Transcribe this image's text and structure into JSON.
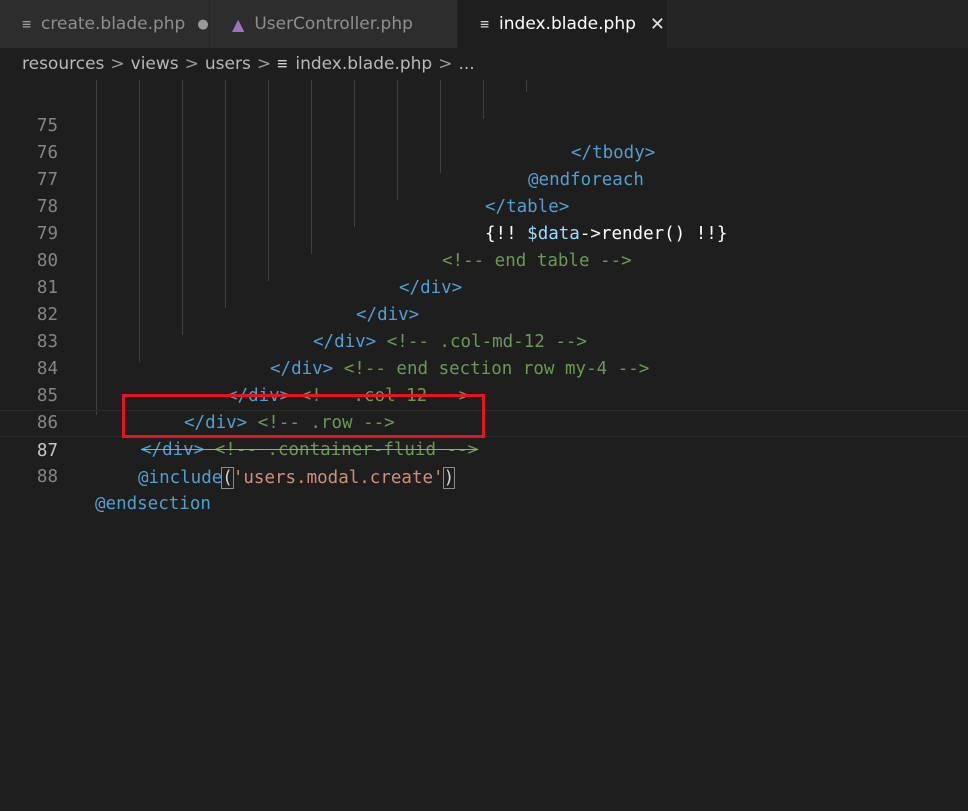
{
  "tabs": [
    {
      "label": "create.blade.php",
      "icon": "file-lines-icon",
      "modified": true
    },
    {
      "label": "UserController.php",
      "icon": "php-elephant-icon",
      "modified": false
    },
    {
      "label": "index.blade.php",
      "icon": "file-lines-icon",
      "active": true
    }
  ],
  "tab_glyphs": {
    "file": "≡",
    "php": "🐘",
    "dot": "●",
    "close": "✕"
  },
  "breadcrumb": {
    "items": [
      "resources",
      "views",
      "users",
      "index.blade.php",
      "..."
    ],
    "sep": ">",
    "file_glyph": "≡"
  },
  "lines": [
    {
      "n": "75",
      "text": "</tbody>"
    },
    {
      "n": "76",
      "text": "@endforeach"
    },
    {
      "n": "77",
      "text": "</table>"
    },
    {
      "n": "78",
      "text": "{!! $data->render() !!}"
    },
    {
      "n": "79",
      "text": "<!-- end table -->"
    },
    {
      "n": "80",
      "text": "</div>"
    },
    {
      "n": "81",
      "text": "</div>"
    },
    {
      "n": "82",
      "text": "</div> <!-- .col-md-12 -->"
    },
    {
      "n": "83",
      "text": "</div> <!-- end section row my-4 -->"
    },
    {
      "n": "84",
      "text": "</div> <!-- .col-12 -->"
    },
    {
      "n": "85",
      "text": "</div> <!-- .row -->"
    },
    {
      "n": "86",
      "text": "</div> <!-- .container-fluid -->"
    },
    {
      "n": "87",
      "text": "@include('users.modal.create')"
    },
    {
      "n": "88",
      "text": "@endsection"
    }
  ],
  "tokens": {
    "l75": "</tbody>",
    "l76": "@endforeach",
    "l77": "</table>",
    "l78a": "{!! ",
    "l78b": "$data",
    "l78c": "->",
    "l78d": "render",
    "l78e": "() ",
    "l78f": "!!}",
    "l79": "<!-- end table -->",
    "l80": "</div>",
    "l81": "</div>",
    "l82a": "</div>",
    "l82b": " <!-- .col-md-12 -->",
    "l83a": "</div>",
    "l83b": " <!-- end section row my-4 -->",
    "l84a": "</div>",
    "l84b": " <!-- .col-12 -->",
    "l85a": "</div>",
    "l85b": " <!-- .row -->",
    "l86a": "</div>",
    "l86b": " <!-- .container-fluid -->",
    "l87a": "@include",
    "l87b": "(",
    "l87c": "'users.modal.create'",
    "l87d": ")",
    "l88": "@endsection"
  },
  "colors": {
    "highlight_box": "#e5141d",
    "tag": "#4fa0d0",
    "comment": "#6a9955",
    "string": "#ce9178"
  }
}
